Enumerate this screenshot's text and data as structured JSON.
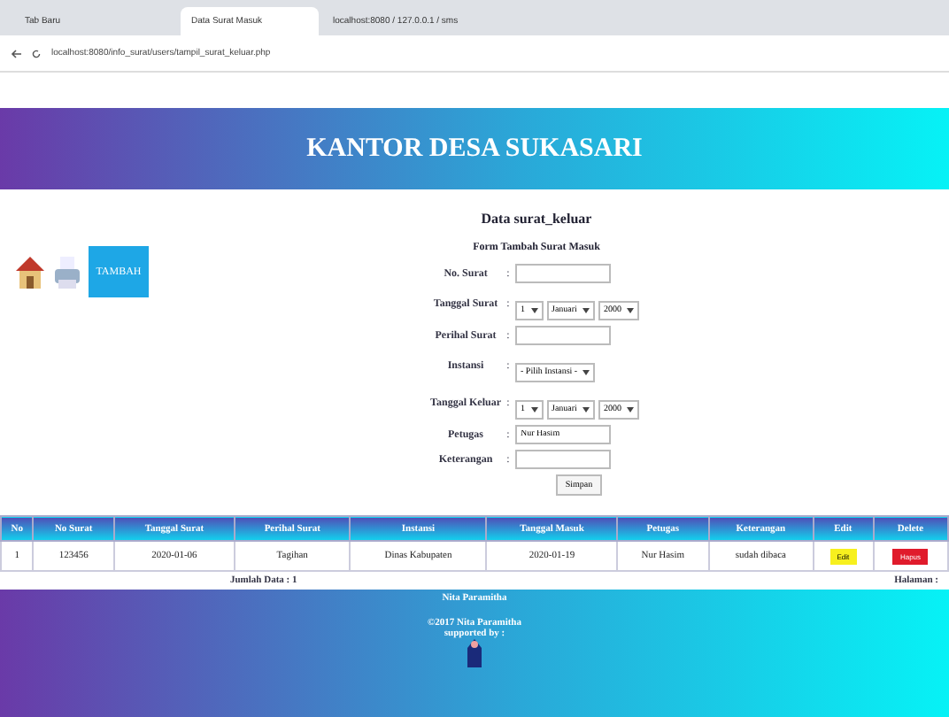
{
  "browser": {
    "tabs": [
      {
        "label": "Tab Baru",
        "selected": false
      },
      {
        "label": "Data Surat Masuk",
        "selected": true
      },
      {
        "label": "localhost:8080 / 127.0.0.1 / sms",
        "selected": false
      }
    ],
    "url": "localhost:8080/info_surat/users/tampil_surat_keluar.php"
  },
  "header": {
    "title": "KANTOR DESA SUKASARI"
  },
  "toolbar": {
    "add_button": "TAMBAH"
  },
  "page_title": "Data surat_keluar",
  "form": {
    "title": "Form Tambah Surat Masuk",
    "fields": [
      {
        "kind": "text",
        "label": "No. Surat",
        "colon": ":"
      },
      {
        "kind": "date",
        "label": "Tanggal Surat",
        "colon": ":",
        "parts": [
          "1",
          "Januari",
          "2000"
        ]
      },
      {
        "kind": "text",
        "label": "Perihal Surat",
        "colon": ":"
      },
      {
        "kind": "select",
        "label": "Instansi",
        "colon": ":",
        "parts": [
          "- Pilih Instansi -"
        ]
      },
      {
        "kind": "date",
        "label": "Tanggal Keluar",
        "colon": ":",
        "parts": [
          "1",
          "Januari",
          "2000"
        ]
      },
      {
        "kind": "text",
        "label": "Petugas",
        "colon": ":",
        "value": "Nur Hasim"
      },
      {
        "kind": "text",
        "label": "Keterangan",
        "colon": ":"
      }
    ],
    "submit": "Simpan"
  },
  "table": {
    "columns": [
      "No",
      "No Surat",
      "Tanggal Surat",
      "Perihal Surat",
      "Instansi",
      "Tanggal Masuk",
      "Petugas",
      "Keterangan",
      "Edit",
      "Delete"
    ],
    "rows": [
      {
        "cells": [
          "1",
          "123456",
          "2020-01-06",
          "Tagihan",
          "Dinas Kabupaten",
          "2020-01-19",
          "Nur Hasim",
          "sudah dibaca"
        ],
        "edit": "Edit",
        "delete": "Hapus"
      }
    ],
    "total": "Jumlah Data : 1",
    "pages": "Halaman :"
  },
  "footer": {
    "name": "Nita Paramitha",
    "copyright": "©2017 Nita Paramitha",
    "supported": "supported by :"
  }
}
